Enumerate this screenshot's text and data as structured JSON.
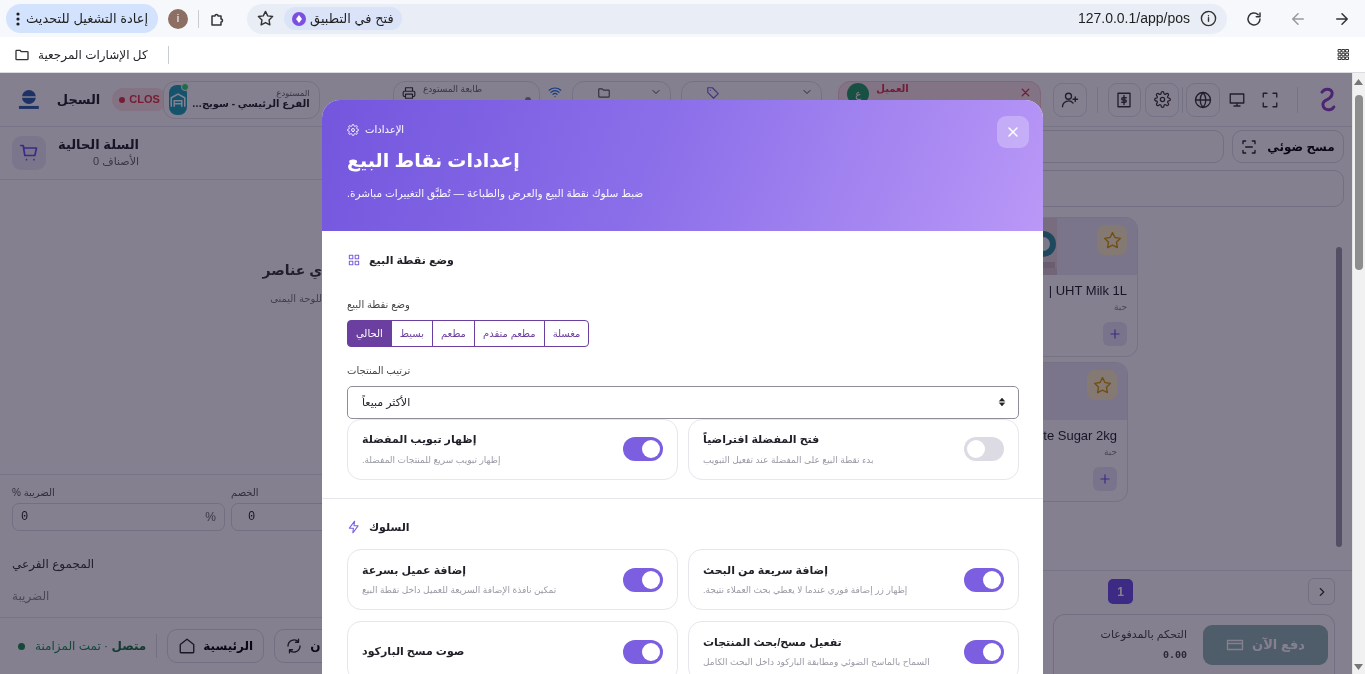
{
  "browser": {
    "relaunch": "إعادة التشغيل للتحديث",
    "profile": "i",
    "open_in_app": "فتح في التطبيق",
    "url": "127.0.0.1/app/pos",
    "bookmarks": "كل الإشارات المرجعية"
  },
  "header": {
    "register": "السجل",
    "session_badge": "CLOS",
    "warehouse_label": "المستودع",
    "warehouse_value": "الفرع الرئيسي - سويج…",
    "printer_label": "طابعة المستودع",
    "customer_label": "العميل",
    "customer_initial": "ع"
  },
  "cart": {
    "title": "السلة الحالية",
    "count": "الأصناف 0",
    "empty_title": "ي عناصر",
    "empty_hint": "للوحة اليمنى",
    "tax_label": "% الضريبة",
    "tax_value": "0",
    "tax_suffix": "%",
    "discount_label": "الخصم",
    "discount_value": "0",
    "subtotal_label": "المجموع الفرعي",
    "tax_total_label": "الضريبة"
  },
  "footer": {
    "status": "**متصل** · تمت المزامنة",
    "home": "الرئيسية",
    "sync": "ن"
  },
  "products_panel": {
    "scan": "مسح ضوئي",
    "products": [
      {
        "name": "| UHT Milk 1L",
        "unit": "حبة"
      },
      {
        "name": "te Sugar 2kg",
        "unit": "حبة"
      }
    ],
    "pages": [
      {
        "label": "1",
        "selected": true
      }
    ],
    "payments_label": "التحكم بالمدفوعات",
    "payments_total": "0.00",
    "pay": "دفع الآن"
  },
  "modal": {
    "breadcrumb": "الإعدادات",
    "title": "إعدادات نقاط البيع",
    "subtitle": "ضبط سلوك نقطة البيع والعرض والطباعة — تُطبَّق التغييرات مباشرة.",
    "sections": [
      {
        "kind": "mode",
        "title": "وضع نقطة البيع",
        "mode_label": "وضع نقطة البيع",
        "modes": [
          {
            "label": "مغسلة",
            "selected": false
          },
          {
            "label": "مطعم متقدم",
            "selected": false
          },
          {
            "label": "مطعم",
            "selected": false
          },
          {
            "label": "بسيط",
            "selected": false
          },
          {
            "label": "الحالي",
            "selected": true
          }
        ],
        "sort_label": "ترتيب المنتجات",
        "sort_value": "الأكثر مبيعاً",
        "toggles": [
          {
            "title": "فتح المفضلة افتراضياً",
            "description": "بدء نقطة البيع على المفضلة عند تفعيل التبويب",
            "on": false
          },
          {
            "title": "إظهار تبويب المفضلة",
            "description": "إظهار تبويب سريع للمنتجات المفضلة.",
            "on": true
          }
        ]
      },
      {
        "kind": "behavior",
        "title": "السلوك",
        "toggles": [
          {
            "title": "إضافة سريعة من البحث",
            "description": "إظهار زر إضافة فوري عندما لا يعطي بحث العملاء نتيجة.",
            "on": true
          },
          {
            "title": "إضافة عميل بسرعة",
            "description": "تمكين نافذة الإضافة السريعة للعميل داخل نقطة البيع",
            "on": true
          },
          {
            "title": "تفعيل مسح/بحث المنتجات",
            "description": "السماح بالماسح الضوئي ومطابقة الباركود داخل البحث الكامل",
            "on": true
          },
          {
            "title": "صوت مسح الباركود",
            "on": true
          }
        ]
      }
    ]
  }
}
